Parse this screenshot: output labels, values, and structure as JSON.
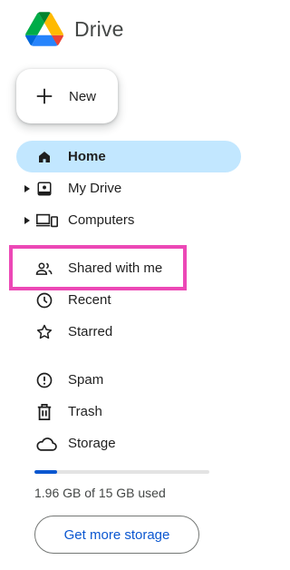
{
  "header": {
    "app_name": "Drive",
    "logo_icon": "google-drive-logo"
  },
  "new_button": {
    "label": "New",
    "icon": "plus-icon"
  },
  "nav": {
    "items": [
      {
        "label": "Home",
        "icon": "home-icon",
        "active": true
      },
      {
        "label": "My Drive",
        "icon": "my-drive-icon",
        "expandable": true
      },
      {
        "label": "Computers",
        "icon": "computers-icon",
        "expandable": true
      },
      {
        "label": "Shared with me",
        "icon": "shared-people-icon",
        "highlighted": true
      },
      {
        "label": "Recent",
        "icon": "clock-icon"
      },
      {
        "label": "Starred",
        "icon": "star-icon"
      },
      {
        "label": "Spam",
        "icon": "spam-icon"
      },
      {
        "label": "Trash",
        "icon": "trash-icon"
      },
      {
        "label": "Storage",
        "icon": "cloud-icon"
      }
    ]
  },
  "storage": {
    "used_text": "1.96 GB of 15 GB used",
    "used_fraction": 0.13,
    "cta_label": "Get more storage"
  },
  "colors": {
    "active_bg": "#c2e7ff",
    "accent": "#0b57d0",
    "highlight_border": "#ec48b6"
  }
}
